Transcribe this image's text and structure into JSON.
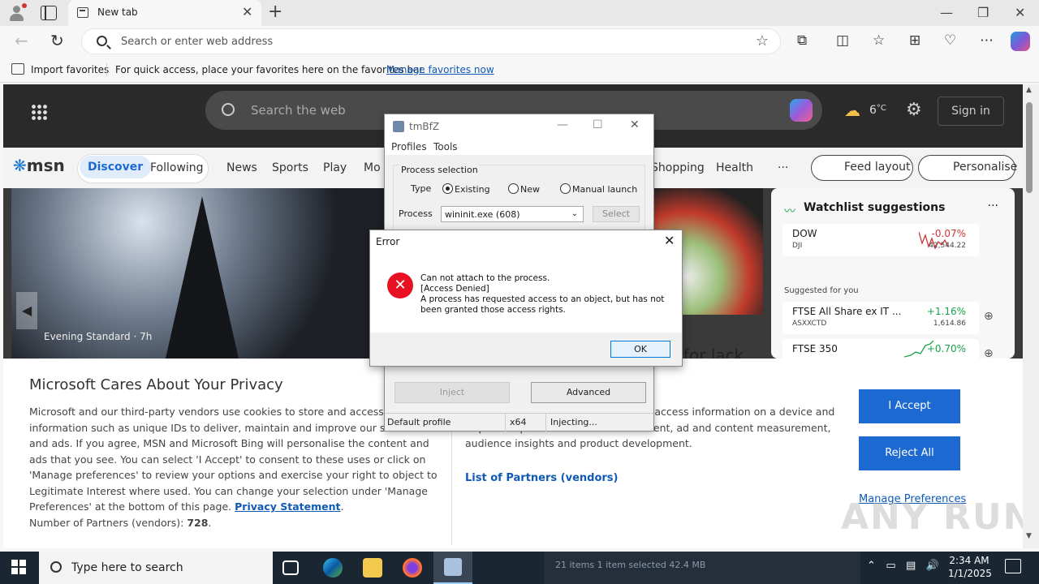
{
  "browser": {
    "tab_title": "New tab",
    "address_placeholder": "Search or enter web address",
    "fav_import": "Import favorites",
    "fav_message": "For quick access, place your favorites here on the favorites bar.",
    "fav_link": "Manage favorites now"
  },
  "msn": {
    "search_placeholder": "Search the web",
    "weather": "6",
    "weather_unit": "°C",
    "signin": "Sign in",
    "logo": "msn",
    "nav": [
      "Discover",
      "Following",
      "News",
      "Sports",
      "Play",
      "Mo",
      "Shopping",
      "Health",
      "···"
    ],
    "feed_layout": "Feed layout",
    "personalise": "Personalise",
    "hero_credit": "Evening Standard · 7h",
    "food_headline": "for lack",
    "watchlist": {
      "title": "Watchlist suggestions",
      "dots": "···",
      "suggested": "Suggested for you",
      "rows": [
        {
          "symbol": "DOW",
          "sub": "DJI",
          "change": "-0.07%",
          "price": "42,544.22"
        },
        {
          "symbol": "FTSE All Share ex IT ...",
          "sub": "ASXXCTD",
          "change": "+1.16%",
          "price": "1,614.86"
        },
        {
          "symbol": "FTSE 350",
          "sub": "",
          "change": "+0.70%",
          "price": ""
        }
      ]
    }
  },
  "privacy": {
    "title": "Microsoft Cares About Your Privacy",
    "text_left": "Microsoft and our third-party vendors use cookies to store and access information such as unique IDs to deliver, maintain and improve our services and ads. If you agree, MSN and Microsoft Bing will personalise the content and ads that you see. You can select 'I Accept' to consent to these uses or click on 'Manage preferences' to review your options and exercise your right to object to Legitimate Interest where used.  You can change your selection under 'Manage Preferences' at the bottom of this page.",
    "privacy_link": "Privacy Statement",
    "partners_label": "Number of Partners (vendors):",
    "partners_count": "728",
    "text_right": "...ly scan device characteristics for ...access information on a device and to provide personalised ads and content, ad and content measurement, audience insights and product development.",
    "list_partners": "List of Partners (vendors)",
    "accept": "I Accept",
    "reject": "Reject All",
    "manage": "Manage Preferences"
  },
  "watermark": "ANY RUN",
  "tmbfz": {
    "title": "tmBfZ",
    "menu": [
      "Profiles",
      "Tools"
    ],
    "group_label": "Process selection",
    "type_label": "Type",
    "type_options": [
      "Existing",
      "New",
      "Manual launch"
    ],
    "type_selected": "Existing",
    "process_label": "Process",
    "process_value": "wininit.exe (608)",
    "select_btn": "Select",
    "inject_btn": "Inject",
    "advanced_btn": "Advanced",
    "status": [
      "Default profile",
      "x64",
      "Injecting..."
    ]
  },
  "error": {
    "title": "Error",
    "line1": "Can not attach to the process.",
    "line2": "[Access Denied]",
    "line3": "A process has requested access to an object, but has not",
    "line4": "been granted those access rights.",
    "ok": "OK"
  },
  "taskbar": {
    "search": "Type here to search",
    "explorer_status": "21 items     1 item selected  42.4 MB",
    "time": "2:34 AM",
    "date": "1/1/2025"
  }
}
